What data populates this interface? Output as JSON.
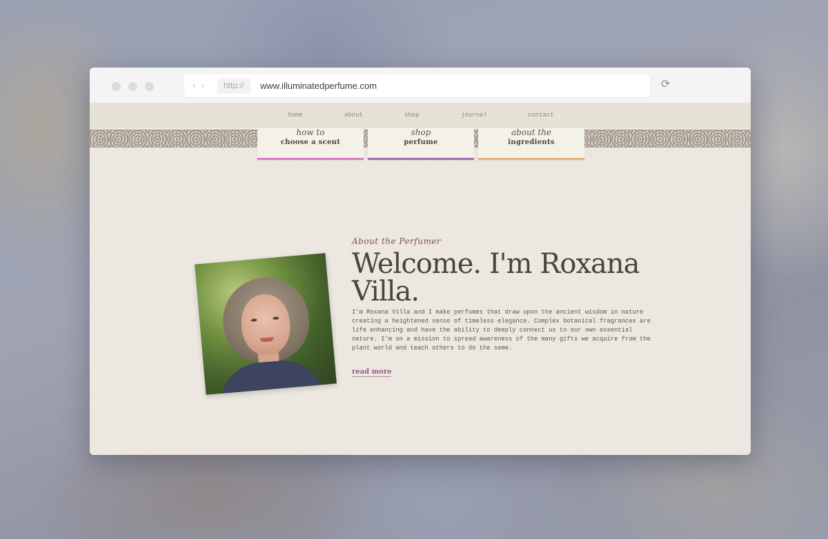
{
  "browser": {
    "protocol": "http://",
    "url": "www.illuminatedperfume.com",
    "back_icon": "chevron-left-icon",
    "forward_icon": "chevron-right-icon",
    "reload_icon": "reload-icon"
  },
  "nav": {
    "items": [
      {
        "label": "home"
      },
      {
        "label": "about"
      },
      {
        "label": "shop"
      },
      {
        "label": "journal"
      },
      {
        "label": "contact"
      }
    ]
  },
  "tabs": [
    {
      "script": "how to",
      "title": "choose a scent",
      "accent": "#d77ac7"
    },
    {
      "script": "shop",
      "title": "perfume",
      "accent": "#9b6ea6"
    },
    {
      "script": "about the",
      "title": "ingredients",
      "accent": "#e0b27a"
    }
  ],
  "hero": {
    "eyebrow": "About the Perfumer",
    "headline": "Welcome. I'm Roxana Villa.",
    "bio": "I'm Roxana Villa and I make perfumes that draw upon the ancient wisdom in nature creating a heightened sense of timeless elegance. Complex botanical fragrances are life enhancing and have the ability to deeply connect us to our own essential nature. I'm on a mission to spread awareness of the many gifts we acquire from the plant world and teach others to do the same.",
    "read_more": "read more"
  }
}
